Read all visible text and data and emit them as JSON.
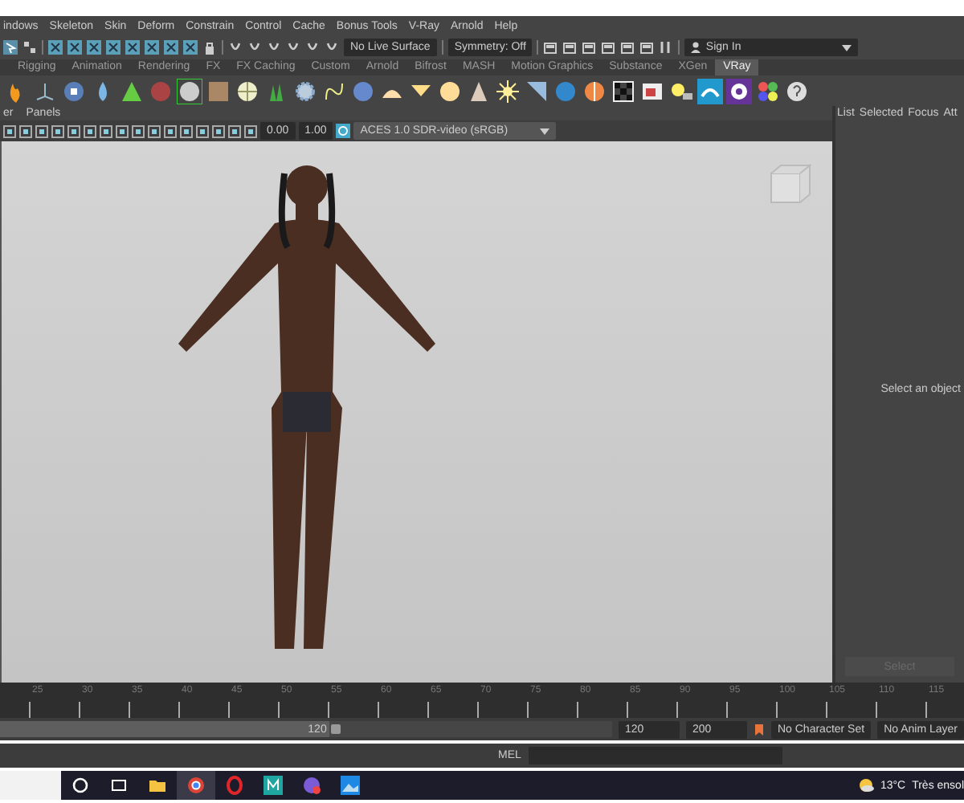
{
  "menu": [
    "indows",
    "Skeleton",
    "Skin",
    "Deform",
    "Constrain",
    "Control",
    "Cache",
    "Bonus Tools",
    "V-Ray",
    "Arnold",
    "Help"
  ],
  "status_line": {
    "live_surface": "No Live Surface",
    "symmetry": "Symmetry: Off",
    "sign_in": "Sign In"
  },
  "shelf_tabs": [
    {
      "label": "Rigging",
      "selected": false
    },
    {
      "label": "Animation",
      "selected": false
    },
    {
      "label": "Rendering",
      "selected": false
    },
    {
      "label": "FX",
      "selected": false
    },
    {
      "label": "FX Caching",
      "selected": false
    },
    {
      "label": "Custom",
      "selected": false
    },
    {
      "label": "Arnold",
      "selected": false
    },
    {
      "label": "Bifrost",
      "selected": false
    },
    {
      "label": "MASH",
      "selected": false
    },
    {
      "label": "Motion Graphics",
      "selected": false
    },
    {
      "label": "Substance",
      "selected": false
    },
    {
      "label": "XGen",
      "selected": false
    },
    {
      "label": "VRay",
      "selected": true
    }
  ],
  "panel_menu": [
    "er",
    "Panels"
  ],
  "viewport_toolbar": {
    "exposure": "0.00",
    "gamma": "1.00",
    "color_space": "ACES 1.0 SDR-video (sRGB)"
  },
  "outliner_menu": [
    "List",
    "Selected",
    "Focus",
    "Att"
  ],
  "attribute_panel": {
    "message": "Select an object",
    "button": {
      "label": "Select",
      "disabled": true
    }
  },
  "time_slider": {
    "ticks": [
      "25",
      "30",
      "35",
      "40",
      "45",
      "50",
      "55",
      "60",
      "65",
      "70",
      "75",
      "80",
      "85",
      "90",
      "95",
      "100",
      "105",
      "110",
      "115"
    ]
  },
  "range_slider": {
    "level": 0.56,
    "handle": "120",
    "end": "120",
    "max": "200",
    "character_set": "No Character Set",
    "anim_layer": "No Anim Layer"
  },
  "command_line": {
    "label": "MEL"
  },
  "taskbar": {
    "temperature": "13°C",
    "weather": "Très ensol"
  }
}
